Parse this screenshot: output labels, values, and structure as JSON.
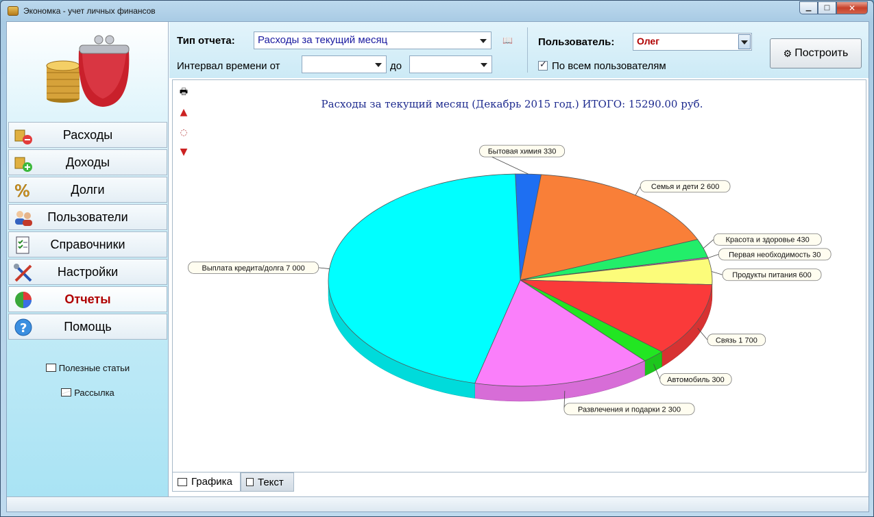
{
  "window": {
    "title": "Экономка - учет личных финансов"
  },
  "sidebar": {
    "items": [
      {
        "label": "Расходы"
      },
      {
        "label": "Доходы"
      },
      {
        "label": "Долги"
      },
      {
        "label": "Пользователи"
      },
      {
        "label": "Справочники"
      },
      {
        "label": "Настройки"
      },
      {
        "label": "Отчеты"
      },
      {
        "label": "Помощь"
      }
    ],
    "active_index": 6,
    "links": [
      {
        "label": "Полезные статьи"
      },
      {
        "label": "Рассылка"
      }
    ]
  },
  "toolbar": {
    "report_type_label": "Тип отчета:",
    "report_type_value": "Расходы за текущий месяц",
    "interval_from_label": "Интервал времени от",
    "interval_from_value": "",
    "interval_to_label": "до",
    "interval_to_value": "",
    "user_label": "Пользователь:",
    "user_value": "Олег",
    "all_users_label": "По всем пользователям",
    "all_users_checked": true,
    "build_label": "Построить"
  },
  "colors": {
    "title": "#1d2a8e",
    "active_nav": "#b00000",
    "user_value": "#b00000"
  },
  "chart_data": {
    "type": "pie",
    "title": "Расходы за текущий месяц (Декабрь 2015 год.) ИТОГО: 15290.00 руб.",
    "unit": "руб.",
    "total": 15290,
    "slices": [
      {
        "name": "Бытовая химия",
        "value": 330,
        "label": "Бытовая химия 330",
        "color": "#1e6ff2"
      },
      {
        "name": "Семья и дети",
        "value": 2600,
        "label": "Семья и дети 2 600",
        "color": "#f97f38"
      },
      {
        "name": "Красота и здоровье",
        "value": 430,
        "label": "Красота и здоровье 430",
        "color": "#22ee6a"
      },
      {
        "name": "Первая необходимость",
        "value": 30,
        "label": "Первая необходимость 30",
        "color": "#d96ad0"
      },
      {
        "name": "Продукты питания",
        "value": 600,
        "label": "Продукты питания 600",
        "color": "#fcfc7a"
      },
      {
        "name": "Связь",
        "value": 1700,
        "label": "Связь 1 700",
        "color": "#fa3a3a"
      },
      {
        "name": "Автомобиль",
        "value": 300,
        "label": "Автомобиль 300",
        "color": "#22e622"
      },
      {
        "name": "Развлечения и подарки",
        "value": 2300,
        "label": "Развлечения и подарки 2 300",
        "color": "#fa7ffa"
      },
      {
        "name": "Выплата кредита/долга",
        "value": 7000,
        "label": "Выплата кредита/долга 7 000",
        "color": "#00ffff"
      }
    ]
  },
  "tabs": [
    {
      "label": "Графика",
      "active": true
    },
    {
      "label": "Текст",
      "active": false
    }
  ]
}
